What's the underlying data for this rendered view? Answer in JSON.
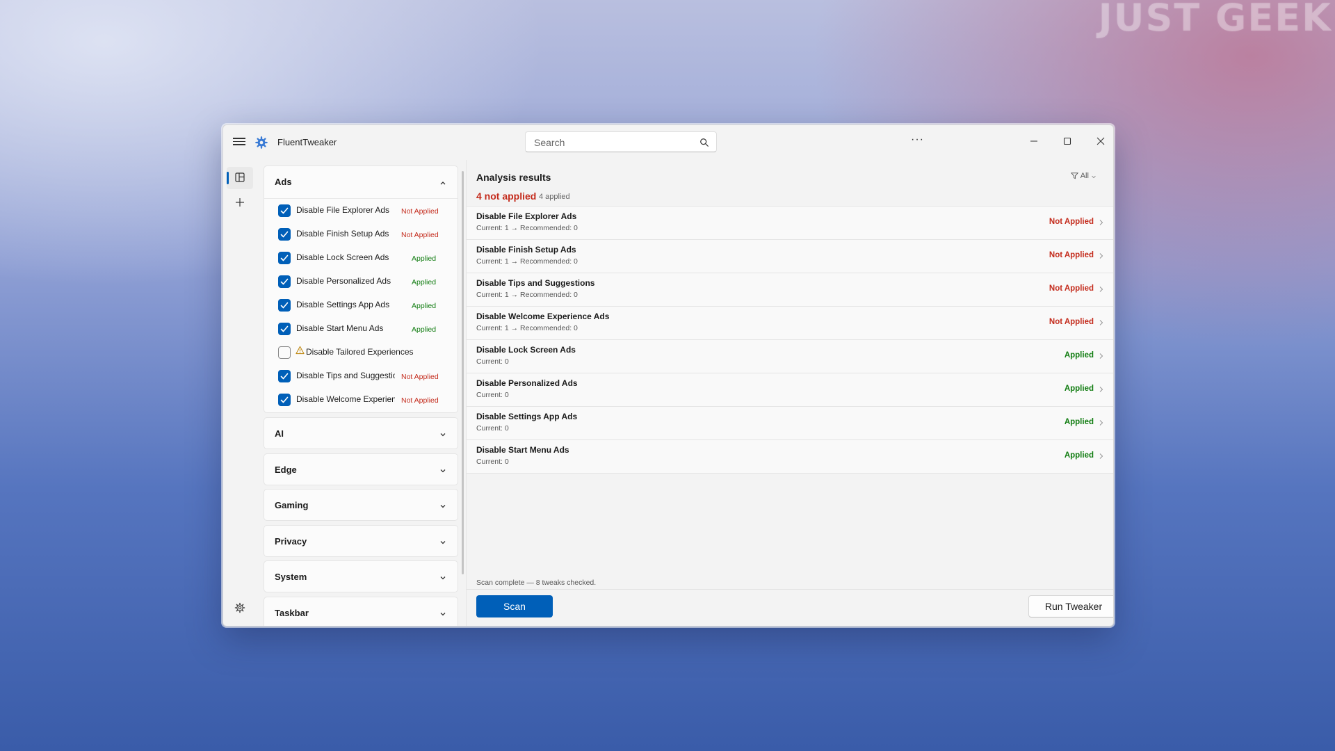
{
  "watermark": "JUST GEEK",
  "app": {
    "title": "FluentTweaker"
  },
  "search": {
    "placeholder": "Search"
  },
  "icons": {
    "menu": "hamburger-icon",
    "app": "gear-icon",
    "search": "search-icon",
    "more": "more-icon",
    "minimize": "minimize-icon",
    "maximize": "maximize-icon",
    "close": "close-icon",
    "tweaks": "tweaks-icon",
    "add": "plus-icon",
    "settings": "settings-icon",
    "warning": "warning-icon",
    "filter": "filter-icon",
    "chevron": "chevron-right-icon"
  },
  "colors": {
    "accent": "#005fb8",
    "not_applied": "#c42b1c",
    "applied": "#107c10",
    "warning": "#c08a16"
  },
  "window_controls": {
    "more": "···"
  },
  "categories": {
    "ads": {
      "title": "Ads",
      "expanded": true,
      "tweaks": [
        {
          "label": "Disable File Explorer Ads",
          "checked": true,
          "status": "Not Applied"
        },
        {
          "label": "Disable Finish Setup Ads",
          "checked": true,
          "status": "Not Applied"
        },
        {
          "label": "Disable Lock Screen Ads",
          "checked": true,
          "status": "Applied"
        },
        {
          "label": "Disable Personalized Ads",
          "checked": true,
          "status": "Applied"
        },
        {
          "label": "Disable Settings App Ads",
          "checked": true,
          "status": "Applied"
        },
        {
          "label": "Disable Start Menu Ads",
          "checked": true,
          "status": "Applied"
        },
        {
          "label": "Disable Tailored Experiences",
          "checked": false,
          "status": "",
          "warning": true
        },
        {
          "label": "Disable Tips and Suggestions",
          "checked": true,
          "status": "Not Applied"
        },
        {
          "label": "Disable Welcome Experience Ads",
          "checked": true,
          "status": "Not Applied"
        }
      ]
    },
    "collapsed": [
      {
        "title": "AI"
      },
      {
        "title": "Edge"
      },
      {
        "title": "Gaming"
      },
      {
        "title": "Privacy"
      },
      {
        "title": "System"
      },
      {
        "title": "Taskbar"
      }
    ]
  },
  "results": {
    "title": "Analysis results",
    "filter_label": "All",
    "not_applied_summary": "4 not applied",
    "separator": "·",
    "applied_summary": "4 applied",
    "items": [
      {
        "name": "Disable File Explorer Ads",
        "detail": "Current: 1  →  Recommended: 0",
        "status": "Not Applied"
      },
      {
        "name": "Disable Finish Setup Ads",
        "detail": "Current: 1  →  Recommended: 0",
        "status": "Not Applied"
      },
      {
        "name": "Disable Tips and Suggestions",
        "detail": "Current: 1  →  Recommended: 0",
        "status": "Not Applied"
      },
      {
        "name": "Disable Welcome Experience Ads",
        "detail": "Current: 1  →  Recommended: 0",
        "status": "Not Applied"
      },
      {
        "name": "Disable Lock Screen Ads",
        "detail": "Current: 0",
        "status": "Applied"
      },
      {
        "name": "Disable Personalized Ads",
        "detail": "Current: 0",
        "status": "Applied"
      },
      {
        "name": "Disable Settings App Ads",
        "detail": "Current: 0",
        "status": "Applied"
      },
      {
        "name": "Disable Start Menu Ads",
        "detail": "Current: 0",
        "status": "Applied"
      }
    ],
    "footer_text": "Scan complete — 8 tweaks checked.",
    "scan_label": "Scan",
    "run_label": "Run Tweaker"
  }
}
